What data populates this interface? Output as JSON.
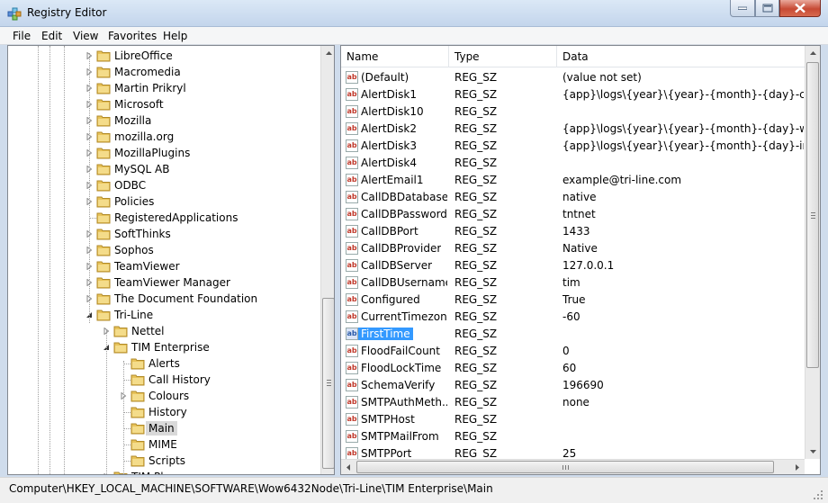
{
  "window": {
    "title": "Registry Editor"
  },
  "menu": [
    "File",
    "Edit",
    "View",
    "Favorites",
    "Help"
  ],
  "tree": {
    "items": [
      {
        "label": "LibreOffice",
        "depth": 0,
        "expander": "collapsed"
      },
      {
        "label": "Macromedia",
        "depth": 0,
        "expander": "collapsed"
      },
      {
        "label": "Martin Prikryl",
        "depth": 0,
        "expander": "collapsed"
      },
      {
        "label": "Microsoft",
        "depth": 0,
        "expander": "collapsed"
      },
      {
        "label": "Mozilla",
        "depth": 0,
        "expander": "collapsed"
      },
      {
        "label": "mozilla.org",
        "depth": 0,
        "expander": "collapsed"
      },
      {
        "label": "MozillaPlugins",
        "depth": 0,
        "expander": "collapsed"
      },
      {
        "label": "MySQL AB",
        "depth": 0,
        "expander": "collapsed"
      },
      {
        "label": "ODBC",
        "depth": 0,
        "expander": "collapsed"
      },
      {
        "label": "Policies",
        "depth": 0,
        "expander": "collapsed"
      },
      {
        "label": "RegisteredApplications",
        "depth": 0,
        "expander": "none"
      },
      {
        "label": "SoftThinks",
        "depth": 0,
        "expander": "collapsed"
      },
      {
        "label": "Sophos",
        "depth": 0,
        "expander": "collapsed"
      },
      {
        "label": "TeamViewer",
        "depth": 0,
        "expander": "collapsed"
      },
      {
        "label": "TeamViewer Manager",
        "depth": 0,
        "expander": "collapsed"
      },
      {
        "label": "The Document Foundation",
        "depth": 0,
        "expander": "collapsed"
      },
      {
        "label": "Tri-Line",
        "depth": 0,
        "expander": "expanded"
      },
      {
        "label": "Nettel",
        "depth": 1,
        "expander": "collapsed"
      },
      {
        "label": "TIM Enterprise",
        "depth": 1,
        "expander": "expanded"
      },
      {
        "label": "Alerts",
        "depth": 2,
        "expander": "none"
      },
      {
        "label": "Call History",
        "depth": 2,
        "expander": "none"
      },
      {
        "label": "Colours",
        "depth": 2,
        "expander": "collapsed"
      },
      {
        "label": "History",
        "depth": 2,
        "expander": "none"
      },
      {
        "label": "Main",
        "depth": 2,
        "expander": "none",
        "selected": true
      },
      {
        "label": "MIME",
        "depth": 2,
        "expander": "none"
      },
      {
        "label": "Scripts",
        "depth": 2,
        "expander": "none"
      },
      {
        "label": "TIM Plus",
        "depth": 1,
        "expander": "collapsed"
      }
    ]
  },
  "list": {
    "columns": [
      "Name",
      "Type",
      "Data"
    ],
    "rows": [
      {
        "name": "(Default)",
        "type": "REG_SZ",
        "data": "(value not set)",
        "icon": "string-value-icon"
      },
      {
        "name": "AlertDisk1",
        "type": "REG_SZ",
        "data": "{app}\\logs\\{year}\\{year}-{month}-{day}-critical.log",
        "icon": "string-value-icon"
      },
      {
        "name": "AlertDisk10",
        "type": "REG_SZ",
        "data": "",
        "icon": "string-value-icon"
      },
      {
        "name": "AlertDisk2",
        "type": "REG_SZ",
        "data": "{app}\\logs\\{year}\\{year}-{month}-{day}-warning.lo",
        "icon": "string-value-icon"
      },
      {
        "name": "AlertDisk3",
        "type": "REG_SZ",
        "data": "{app}\\logs\\{year}\\{year}-{month}-{day}-informatio",
        "icon": "string-value-icon"
      },
      {
        "name": "AlertDisk4",
        "type": "REG_SZ",
        "data": "",
        "icon": "string-value-icon"
      },
      {
        "name": "AlertEmail1",
        "type": "REG_SZ",
        "data": "example@tri-line.com",
        "icon": "string-value-icon"
      },
      {
        "name": "CallDBDatabase",
        "type": "REG_SZ",
        "data": "native",
        "icon": "string-value-icon"
      },
      {
        "name": "CallDBPassword",
        "type": "REG_SZ",
        "data": "tntnet",
        "icon": "string-value-icon"
      },
      {
        "name": "CallDBPort",
        "type": "REG_SZ",
        "data": "1433",
        "icon": "string-value-icon"
      },
      {
        "name": "CallDBProvider",
        "type": "REG_SZ",
        "data": "Native",
        "icon": "string-value-icon"
      },
      {
        "name": "CallDBServer",
        "type": "REG_SZ",
        "data": "127.0.0.1",
        "icon": "string-value-icon"
      },
      {
        "name": "CallDBUsername",
        "type": "REG_SZ",
        "data": "tim",
        "icon": "string-value-icon"
      },
      {
        "name": "Configured",
        "type": "REG_SZ",
        "data": "True",
        "icon": "string-value-icon"
      },
      {
        "name": "CurrentTimezone",
        "type": "REG_SZ",
        "data": "-60",
        "icon": "string-value-icon"
      },
      {
        "name": "FirstTime",
        "type": "REG_SZ",
        "data": "",
        "icon": "string-value-icon",
        "selected": true
      },
      {
        "name": "FloodFailCount",
        "type": "REG_SZ",
        "data": "0",
        "icon": "string-value-icon"
      },
      {
        "name": "FloodLockTime",
        "type": "REG_SZ",
        "data": "60",
        "icon": "string-value-icon"
      },
      {
        "name": "SchemaVerify",
        "type": "REG_SZ",
        "data": "196690",
        "icon": "string-value-icon"
      },
      {
        "name": "SMTPAuthMeth...",
        "type": "REG_SZ",
        "data": "none",
        "icon": "string-value-icon"
      },
      {
        "name": "SMTPHost",
        "type": "REG_SZ",
        "data": "",
        "icon": "string-value-icon"
      },
      {
        "name": "SMTPMailFrom",
        "type": "REG_SZ",
        "data": "",
        "icon": "string-value-icon"
      },
      {
        "name": "SMTPPort",
        "type": "REG_SZ",
        "data": "25",
        "icon": "string-value-icon"
      }
    ]
  },
  "status": {
    "path": "Computer\\HKEY_LOCAL_MACHINE\\SOFTWARE\\Wow6432Node\\Tri-Line\\TIM Enterprise\\Main"
  },
  "colors": {
    "selection": "#3399ff",
    "folder": "#e8c35a",
    "string_icon": "#c0392b"
  }
}
